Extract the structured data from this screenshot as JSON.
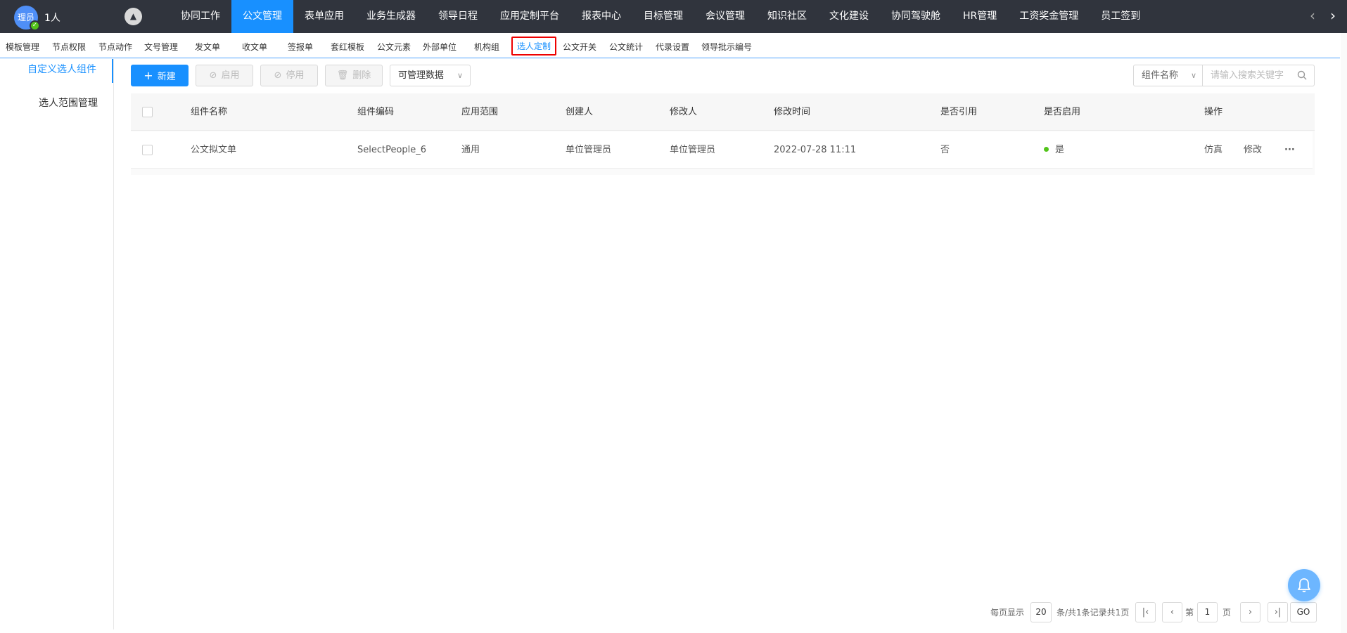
{
  "header": {
    "avatar_text": "理员",
    "user_count": "1人",
    "nav": [
      "协同工作",
      "公文管理",
      "表单应用",
      "业务生成器",
      "领导日程",
      "应用定制平台",
      "报表中心",
      "目标管理",
      "会议管理",
      "知识社区",
      "文化建设",
      "协同驾驶舱",
      "HR管理",
      "工资奖金管理",
      "员工签到"
    ],
    "active_nav": "公文管理"
  },
  "subnav": {
    "items": [
      "模板管理",
      "节点权限",
      "节点动作",
      "文号管理",
      "发文单",
      "收文单",
      "签报单",
      "套红模板",
      "公文元素",
      "外部单位",
      "机构组",
      "选人定制",
      "公文开关",
      "公文统计",
      "代录设置",
      "领导批示编号"
    ],
    "active": "选人定制"
  },
  "sidebar": {
    "items": [
      "自定义选人组件",
      "选人范围管理"
    ],
    "active": "自定义选人组件"
  },
  "toolbar": {
    "new_label": "新建",
    "enable_label": "启用",
    "disable_label": "停用",
    "delete_label": "删除",
    "data_filter_label": "可管理数据"
  },
  "search": {
    "field_label": "组件名称",
    "placeholder": "请输入搜索关键字"
  },
  "table": {
    "columns": [
      "组件名称",
      "组件编码",
      "应用范围",
      "创建人",
      "修改人",
      "修改时间",
      "是否引用",
      "是否启用",
      "操作"
    ],
    "rows": [
      {
        "name": "公文拟文单",
        "code": "SelectPeople_6",
        "scope": "通用",
        "creator": "单位管理员",
        "modifier": "单位管理员",
        "modified_time": "2022-07-28 11:11",
        "referenced": "否",
        "enabled": "是",
        "action_simulate": "仿真",
        "action_edit": "修改",
        "action_more": "···"
      }
    ]
  },
  "pagination": {
    "per_page_label": "每页显示",
    "per_page": "20",
    "summary": "条/共1条记录共1页",
    "page_prefix": "第",
    "current_page": "1",
    "page_suffix": "页",
    "go_label": "GO"
  },
  "colors": {
    "topbar": "#30343d",
    "accent": "#1890ff",
    "highlight_border": "#e00000",
    "status_green": "#52c41a"
  }
}
